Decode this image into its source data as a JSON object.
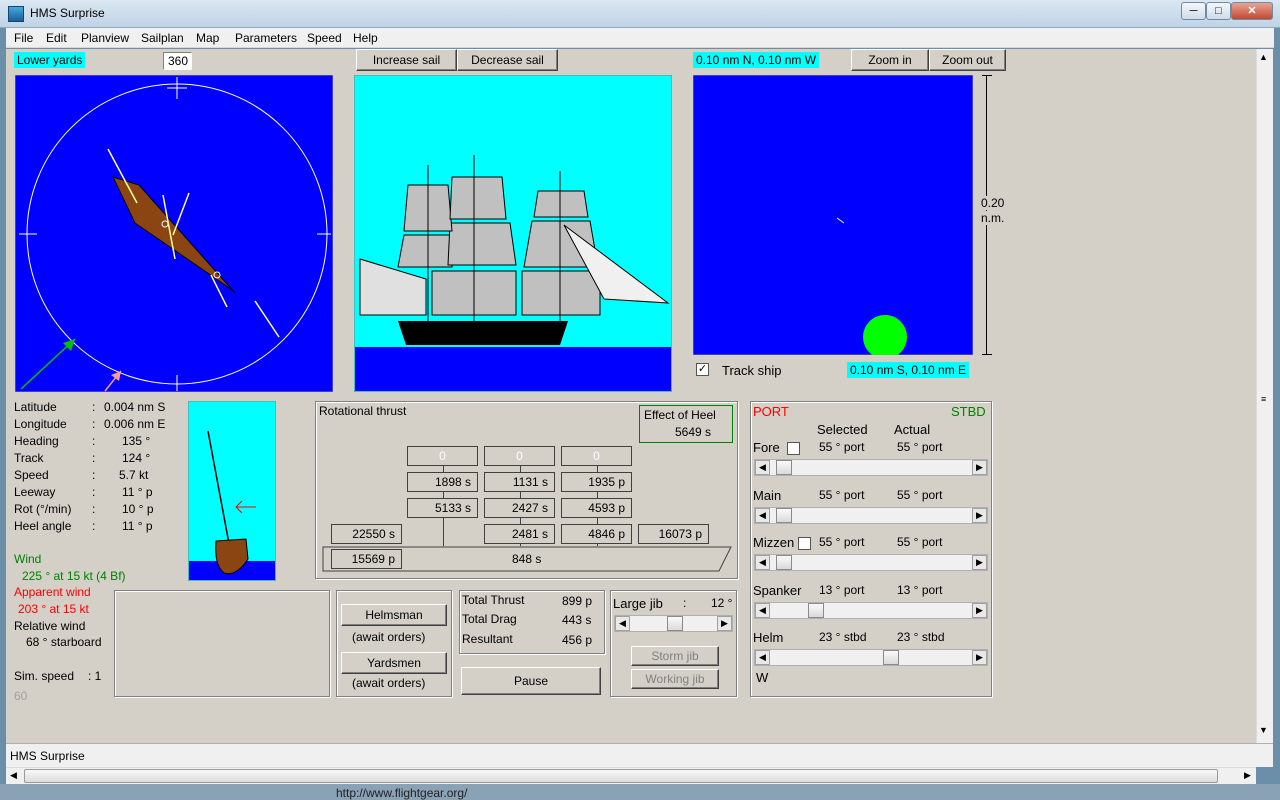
{
  "window": {
    "title": "HMS Surprise",
    "minimize": "─",
    "maximize": "□",
    "close": "✕"
  },
  "menu": [
    "File",
    "Edit",
    "Planview",
    "Sailplan",
    "Map",
    "Parameters",
    "Speed",
    "Help"
  ],
  "planview": {
    "mode_label": "Lower yards",
    "angle_value": "360"
  },
  "sailplan": {
    "increase_label": "Increase sail",
    "decrease_label": "Decrease sail"
  },
  "map": {
    "top_coords": "0.10 nm N, 0.10 nm W",
    "zoom_in": "Zoom in",
    "zoom_out": "Zoom out",
    "scale_value": "0.20",
    "scale_unit": "n.m.",
    "track_ship_label": "Track ship",
    "track_ship_checked": "✓",
    "bottom_coords": "0.10 nm S, 0.10 nm E"
  },
  "nav": {
    "rows": [
      {
        "label": "Latitude",
        "sep": ":",
        "value": "0.004 nm S"
      },
      {
        "label": "Longitude",
        "sep": ":",
        "value": "0.006 nm E"
      },
      {
        "label": "Heading",
        "sep": ":",
        "value": "135 °"
      },
      {
        "label": "Track",
        "sep": ":",
        "value": "124 °"
      },
      {
        "label": "Speed",
        "sep": ":",
        "value": "5.7 kt"
      },
      {
        "label": "Leeway",
        "sep": ":",
        "value": "11 ° p"
      },
      {
        "label": "Rot (°/min)",
        "sep": ":",
        "value": "10 ° p"
      },
      {
        "label": "Heel angle",
        "sep": ":",
        "value": "11 ° p"
      }
    ],
    "wind_label": "Wind",
    "wind_value": "225 ° at 15 kt (4 Bf)",
    "apparent_label": "Apparent wind",
    "apparent_value": "203 ° at 15 kt",
    "relative_label": "Relative wind",
    "relative_value": "68 ° starboard",
    "simspeed_label": "Sim. speed",
    "simspeed_value": ": 1",
    "fps": "60"
  },
  "thrust": {
    "title": "Rotational thrust",
    "heel_title": "Effect of Heel",
    "heel_value": "5649 s",
    "row0": [
      "0",
      "0",
      "0"
    ],
    "row1": [
      "1898 s",
      "1131 s",
      "1935 p"
    ],
    "row2": [
      "5133 s",
      "2427 s",
      "4593 p"
    ],
    "row3": [
      "22550 s",
      "2481 s",
      "4846 p",
      "16073 p"
    ],
    "hull_left": "15569 p",
    "hull_center": "848 s"
  },
  "crew": {
    "helmsman_label": "Helmsman",
    "helmsman_status": "(await orders)",
    "yardsmen_label": "Yardsmen",
    "yardsmen_status": "(await orders)"
  },
  "totals": {
    "thrust_label": "Total Thrust",
    "thrust_value": "899 p",
    "drag_label": "Total Drag",
    "drag_value": "443 s",
    "result_label": "Resultant",
    "result_value": "456 p",
    "pause_label": "Pause"
  },
  "jib": {
    "label": "Large jib",
    "sep": ":",
    "value": "12 °",
    "storm_label": "Storm jib",
    "working_label": "Working jib",
    "level": 0.5
  },
  "yards": {
    "port_label": "PORT",
    "stbd_label": "STBD",
    "selected_header": "Selected",
    "actual_header": "Actual",
    "rows": [
      {
        "name": "Fore",
        "selected": "55 ° port",
        "actual": "55 ° port",
        "level": 0.03
      },
      {
        "name": "Main",
        "selected": "55 ° port",
        "actual": "55 ° port",
        "level": 0.03
      },
      {
        "name": "Mizzen",
        "selected": "55 ° port",
        "actual": "55 ° port",
        "level": 0.03
      },
      {
        "name": "Spanker",
        "selected": "13 ° port",
        "actual": "13 ° port",
        "level": 0.2
      },
      {
        "name": "Helm",
        "selected": "23 ° stbd",
        "actual": "23 ° stbd",
        "level": 0.6
      }
    ],
    "helm_footer": "W"
  },
  "status_text": "HMS Surprise",
  "taskbar_url": "http://www.flightgear.org/",
  "colors": {
    "sea": "#0000ff",
    "sky": "#00ffff",
    "hull": "#8b4513",
    "port": "#ff0000",
    "stbd": "#008000"
  }
}
